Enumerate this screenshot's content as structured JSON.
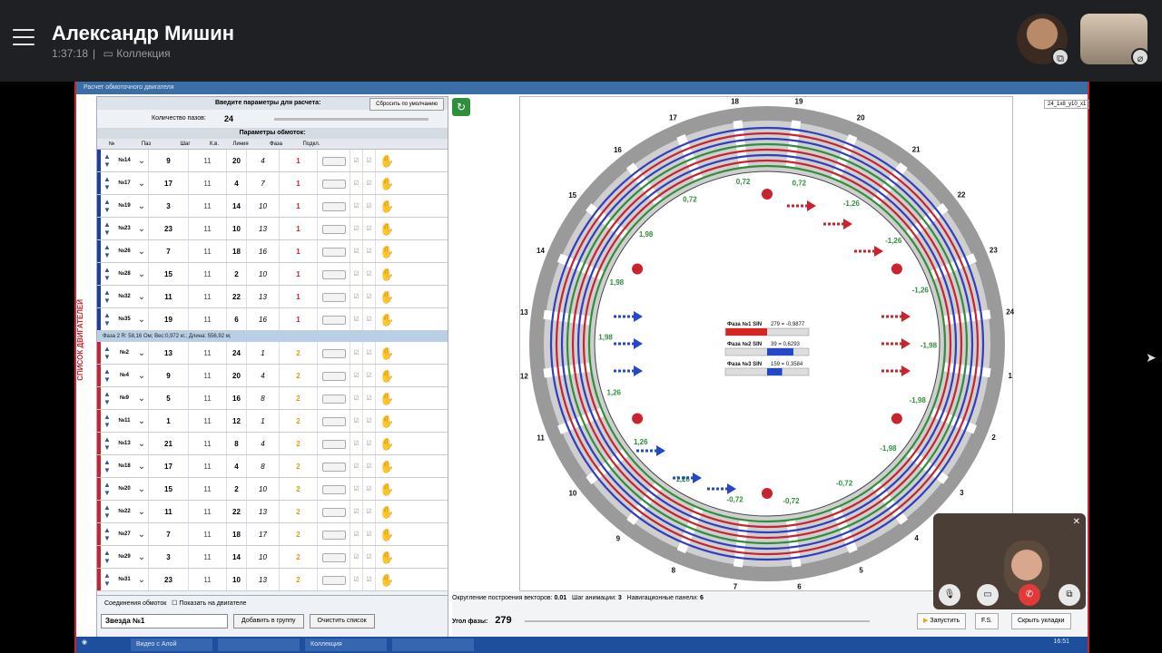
{
  "call": {
    "name": "Александр Мишин",
    "duration": "1:37:18",
    "separator": "|",
    "collection_label": "Коллекция"
  },
  "app": {
    "titlebar": "Расчет обмоточного двигателя",
    "side_tab": "СПИСОК ДВИГАТЕЛЕЙ",
    "params_header": "Введите параметры для расчета:",
    "reset_button": "Сбросить по умолчанию",
    "slots_label": "Количество пазов:",
    "slots_value": "24",
    "coils_header": "Параметры обмоток:",
    "columns": [
      "№",
      "Паз",
      "Шаг",
      "К.в.",
      "Линия",
      "Фаза",
      "Подкл."
    ],
    "phase2_bar": "Фаза 2      R: 58,16 Ом; Вес:0,972 кг.; Длина: 556,92 м;",
    "corner_label": "24_1x8_y10_x1"
  },
  "coils_phase1": [
    {
      "id": "№14",
      "slot": "9",
      "step": "11",
      "k": "20",
      "line": "4",
      "phase": "1"
    },
    {
      "id": "№17",
      "slot": "17",
      "step": "11",
      "k": "4",
      "line": "7",
      "phase": "1"
    },
    {
      "id": "№19",
      "slot": "3",
      "step": "11",
      "k": "14",
      "line": "10",
      "phase": "1"
    },
    {
      "id": "№23",
      "slot": "23",
      "step": "11",
      "k": "10",
      "line": "13",
      "phase": "1"
    },
    {
      "id": "№26",
      "slot": "7",
      "step": "11",
      "k": "18",
      "line": "16",
      "phase": "1"
    },
    {
      "id": "№28",
      "slot": "15",
      "step": "11",
      "k": "2",
      "line": "10",
      "phase": "1"
    },
    {
      "id": "№32",
      "slot": "11",
      "step": "11",
      "k": "22",
      "line": "13",
      "phase": "1"
    },
    {
      "id": "№35",
      "slot": "19",
      "step": "11",
      "k": "6",
      "line": "16",
      "phase": "1"
    }
  ],
  "coils_phase2": [
    {
      "id": "№2",
      "slot": "13",
      "step": "11",
      "k": "24",
      "line": "1",
      "phase": "2"
    },
    {
      "id": "№4",
      "slot": "9",
      "step": "11",
      "k": "20",
      "line": "4",
      "phase": "2"
    },
    {
      "id": "№9",
      "slot": "5",
      "step": "11",
      "k": "16",
      "line": "8",
      "phase": "2"
    },
    {
      "id": "№11",
      "slot": "1",
      "step": "11",
      "k": "12",
      "line": "1",
      "phase": "2"
    },
    {
      "id": "№13",
      "slot": "21",
      "step": "11",
      "k": "8",
      "line": "4",
      "phase": "2"
    },
    {
      "id": "№18",
      "slot": "17",
      "step": "11",
      "k": "4",
      "line": "8",
      "phase": "2"
    },
    {
      "id": "№20",
      "slot": "15",
      "step": "11",
      "k": "2",
      "line": "10",
      "phase": "2"
    },
    {
      "id": "№22",
      "slot": "11",
      "step": "11",
      "k": "22",
      "line": "13",
      "phase": "2"
    },
    {
      "id": "№27",
      "slot": "7",
      "step": "11",
      "k": "18",
      "line": "17",
      "phase": "2"
    },
    {
      "id": "№29",
      "slot": "3",
      "step": "11",
      "k": "14",
      "line": "10",
      "phase": "2"
    },
    {
      "id": "№31",
      "slot": "23",
      "step": "11",
      "k": "10",
      "line": "13",
      "phase": "2"
    }
  ],
  "bottom": {
    "connections_label": "Соединения обмоток",
    "show_on_motor": "Показать на двигателе",
    "star_select": "Звезда №1",
    "add_group": "Добавить в группу",
    "clear_list": "Очистить список",
    "vector_round": "Округление построения векторов:",
    "vector_round_value": "0.01",
    "anim_step": "Шаг анимации:",
    "anim_step_value": "3",
    "nav_label": "Навигационные панели:",
    "nav_value": "6",
    "phase_angle_label": "Угол фазы:",
    "phase_angle_value": "279",
    "start_btn": "Запустить",
    "hide_btn": "Скрыть укладки",
    "fit_btn": "F.S."
  },
  "phase_table": [
    {
      "label": "Фаза №1 SIN",
      "value": "279 = -0,9877",
      "color": "#d92424",
      "fill": 0.99,
      "negative": true
    },
    {
      "label": "Фаза №2 SIN",
      "value": "39 = 0,6293",
      "color": "#2448c9",
      "fill": 0.63,
      "negative": false
    },
    {
      "label": "Фаза №3 SIN",
      "value": "159 = 0,3584",
      "color": "#2448c9",
      "fill": 0.36,
      "negative": false
    }
  ],
  "slot_numbers": [
    "1",
    "2",
    "3",
    "4",
    "5",
    "6",
    "7",
    "8",
    "9",
    "10",
    "11",
    "12",
    "13",
    "14",
    "15",
    "16",
    "17",
    "18",
    "19",
    "20",
    "21",
    "22",
    "23",
    "24"
  ],
  "vector_labels": [
    "0,72",
    "-1,26",
    "-1,26",
    "-1,26",
    "-1,98",
    "-1,98",
    "-1,98",
    "-0,72",
    "-0,72",
    "-0,72",
    "1,26",
    "1,26",
    "1,26",
    "1,98",
    "1,98",
    "1,98",
    "0,72",
    "0,72"
  ],
  "taskbar_items": [
    "Видео с Алой",
    "",
    "Коллекция",
    ""
  ],
  "taskbar_time": "16:51"
}
